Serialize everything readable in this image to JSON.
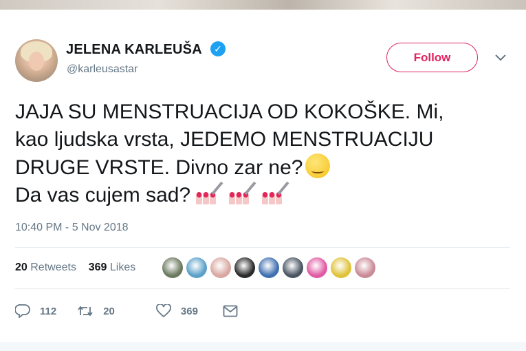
{
  "author": {
    "name": "JELENA KARLEUŠA",
    "handle": "@karleusastar",
    "verified": true
  },
  "follow_button": {
    "label": "Follow",
    "color": "#e0245e"
  },
  "tweet": {
    "lines": [
      "JAJA SU MENSTRUACIJA OD KOKOŠKE. Mi,",
      "kao ljudska vrsta, JEDEMO MENSTRUACIJU",
      "DRUGE VRSTE. Divno zar ne?",
      "Da vas cujem sad?"
    ],
    "emojis": [
      "smirking-face",
      "nail-polish",
      "nail-polish",
      "nail-polish"
    ],
    "timestamp": "10:40 PM - 5 Nov 2018"
  },
  "stats": {
    "retweets_count": "20",
    "retweets_label": "Retweets",
    "likes_count": "369",
    "likes_label": "Likes"
  },
  "liker_avatar_colors": [
    "#6b7a5e",
    "#5aa0c8",
    "#d9a7a0",
    "#2b2b2b",
    "#3f6fb0",
    "#4a5563",
    "#e05aa3",
    "#e0c23a",
    "#c98a96"
  ],
  "actions": {
    "reply_count": "112",
    "retweet_count": "20",
    "like_count": "369"
  },
  "colors": {
    "text": "#14171a",
    "secondary": "#657786",
    "verified": "#1da1f2",
    "divider": "#e6ecf0"
  }
}
